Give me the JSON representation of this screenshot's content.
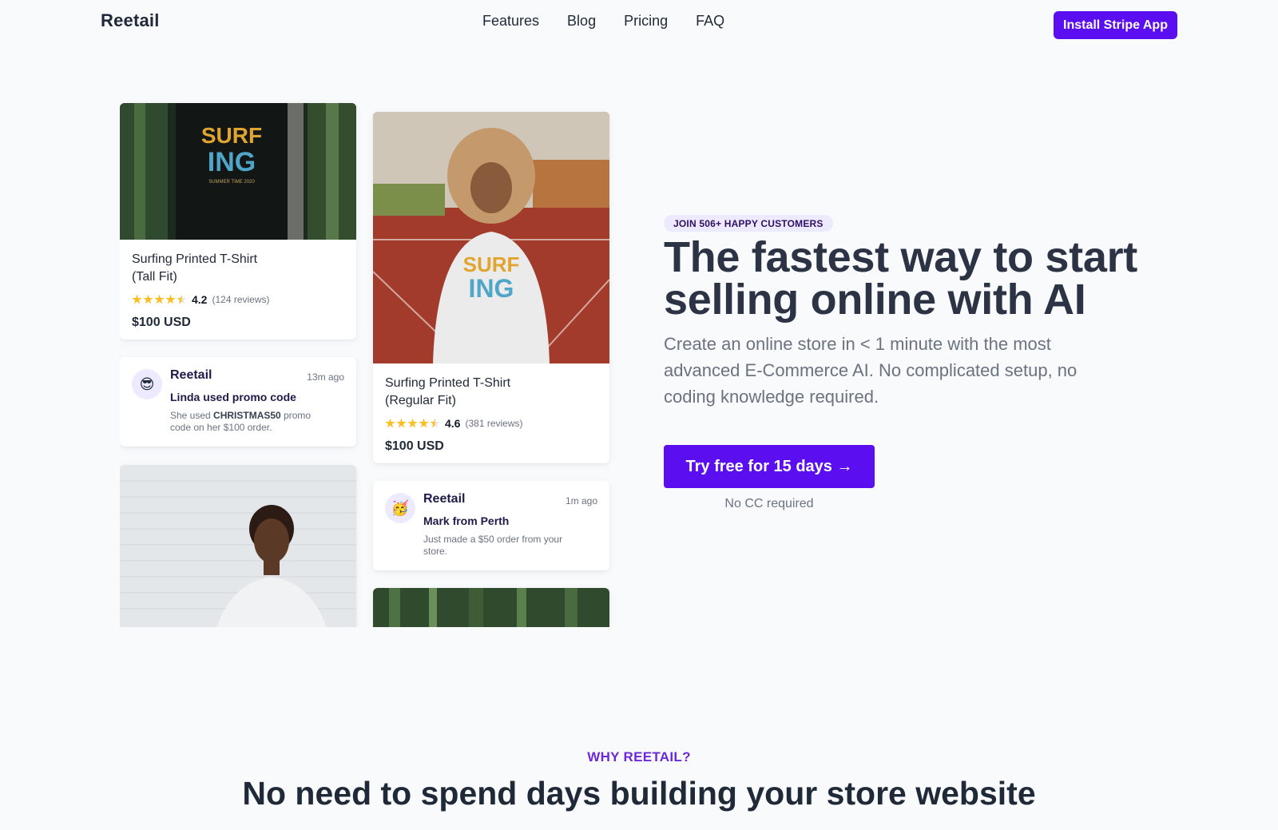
{
  "nav": {
    "logo": "Reetail",
    "links": [
      "Features",
      "Blog",
      "Pricing",
      "FAQ"
    ],
    "install_label": "Install Stripe App"
  },
  "products": [
    {
      "title_line1": "Surfing Printed T-Shirt",
      "title_line2": "(Tall Fit)",
      "rating": "4.2",
      "reviews": "(124 reviews)",
      "price": "$100 USD"
    },
    {
      "title_line1": "Surfing Printed T-Shirt",
      "title_line2": "(Regular Fit)",
      "rating": "4.6",
      "reviews": "(381 reviews)",
      "price": "$100 USD"
    }
  ],
  "notifications": [
    {
      "emoji": "😎",
      "brand": "Reetail",
      "time": "13m ago",
      "heading": "Linda used promo code",
      "body_pre": "She used ",
      "code": "CHRISTMAS50",
      "body_post": " promo code on her $100 order."
    },
    {
      "emoji": "🥳",
      "brand": "Reetail",
      "time": "1m ago",
      "heading": "Mark from Perth",
      "body": "Just made a $50 order from your store."
    }
  ],
  "hero": {
    "badge": "JOIN 506+ HAPPY CUSTOMERS",
    "headline": "The fastest way to start selling online with AI",
    "subtitle": "Create an online store in < 1 minute with the most advanced E-Commerce AI. No complicated setup, no coding knowledge required.",
    "cta_label": "Try free for 15 days →",
    "cta_note": "No CC required"
  },
  "why": {
    "label": "WHY REETAIL?",
    "title": "No need to spend days building your store website"
  },
  "colors": {
    "accent": "#5b0ef0",
    "background": "#f8fafc",
    "badge_bg": "#ede9fe"
  }
}
